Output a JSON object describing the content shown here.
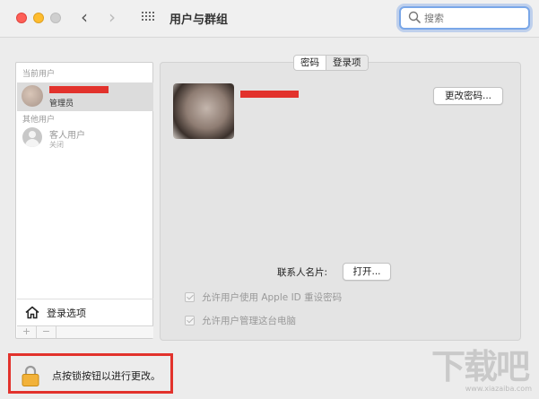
{
  "window": {
    "title": "用户与群组",
    "back_icon": "chevron-left-icon",
    "forward_icon": "chevron-right-icon",
    "grid_icon": "show-all-grid-icon"
  },
  "search": {
    "placeholder": "搜索",
    "icon": "search-icon"
  },
  "sidebar": {
    "current_users_label": "当前用户",
    "current_user": {
      "role": "管理员"
    },
    "other_users_label": "其他用户",
    "guest_user": {
      "name": "客人用户",
      "status": "关闭"
    },
    "login_options_label": "登录选项",
    "add_label": "+",
    "remove_label": "−"
  },
  "main": {
    "tabs": [
      {
        "label": "密码"
      },
      {
        "label": "登录项"
      }
    ],
    "change_password_label": "更改密码...",
    "contact_card_label": "联系人名片:",
    "open_label": "打开...",
    "checkboxes": [
      {
        "label": "允许用户使用 Apple ID 重设密码",
        "checked": true,
        "enabled": false
      },
      {
        "label": "允许用户管理这台电脑",
        "checked": true,
        "enabled": false
      }
    ]
  },
  "lock": {
    "label": "点按锁按钮以进行更改。",
    "highlight_color": "#e2322c"
  },
  "watermark": {
    "text": "下载吧",
    "url": "www.xiazaiba.com"
  },
  "colors": {
    "redaction": "#e2322c",
    "search_focus": "#7aa7e8"
  }
}
